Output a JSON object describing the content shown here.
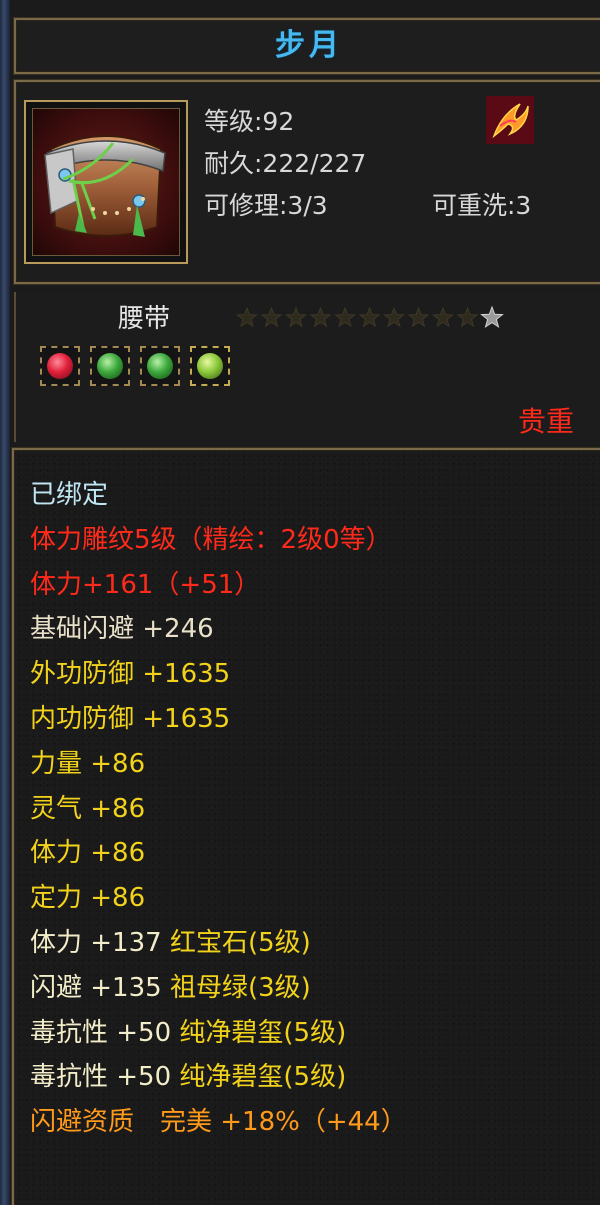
{
  "item": {
    "name": "步月",
    "level_label": "等级:92",
    "durability_label": "耐久:222/227",
    "repair_label": "可修理:3/3",
    "rewash_label": "可重洗:3",
    "type": "腰带",
    "rarity": "贵重",
    "star_count": 11,
    "lit_stars": 0
  },
  "gems": [
    {
      "name": "ruby",
      "color": "#e0203a"
    },
    {
      "name": "emerald",
      "color": "#3ca83c"
    },
    {
      "name": "emerald",
      "color": "#3ca83c"
    },
    {
      "name": "jade",
      "color": "#8ac83a"
    }
  ],
  "attributes": [
    {
      "text": "已绑定",
      "color": "#bfe6f2"
    },
    {
      "text": "体力雕纹5级（精绘：2级0等）",
      "color": "#ff2a1a"
    },
    {
      "text": "体力+161（+51）",
      "color": "#ff2a1a"
    },
    {
      "text": "基础闪避 +246",
      "color": "#e8e0c8"
    },
    {
      "text": "外功防御 +1635",
      "color": "#f2d21a"
    },
    {
      "text": "内功防御 +1635",
      "color": "#f2d21a"
    },
    {
      "text": "力量 +86",
      "color": "#f2d21a"
    },
    {
      "text": "灵气 +86",
      "color": "#f2d21a"
    },
    {
      "text": "体力 +86",
      "color": "#f2d21a"
    },
    {
      "text": "定力 +86",
      "color": "#f2d21a"
    },
    {
      "text": "体力 +137 红宝石(5级)",
      "color": "#f2ecc8",
      "extra_color": "#f2d21a"
    },
    {
      "text": "闪避 +135 祖母绿(3级)",
      "color": "#f2ecc8",
      "extra_color": "#f2d21a"
    },
    {
      "text": "毒抗性 +50 纯净碧玺(5级)",
      "color": "#f2ecc8",
      "extra_color": "#f2d21a"
    },
    {
      "text": "毒抗性 +50 纯净碧玺(5级)",
      "color": "#f2ecc8",
      "extra_color": "#f2d21a"
    },
    {
      "text": "闪避资质　完美 +18%（+44）",
      "color": "#ff9a1a"
    }
  ]
}
